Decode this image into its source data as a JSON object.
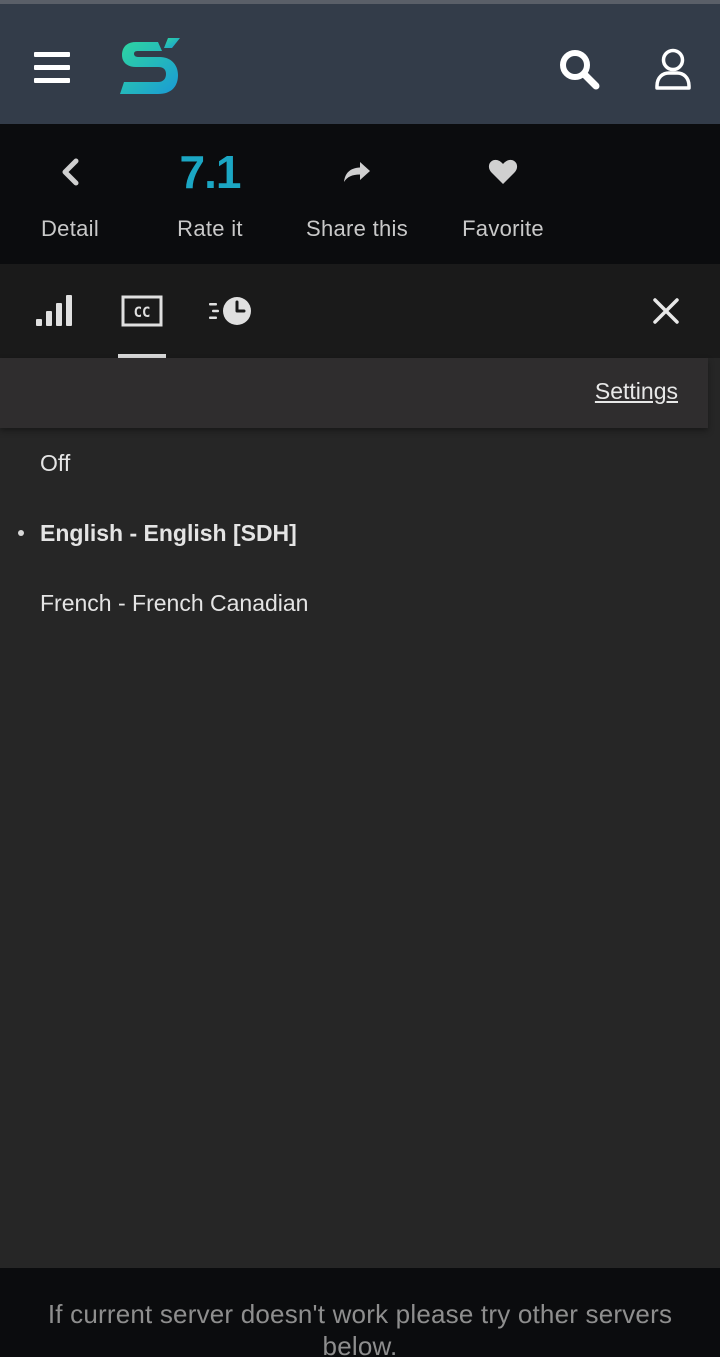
{
  "colors": {
    "header_bg": "#333c49",
    "action_bar_bg": "#0b0c0e",
    "panel_bg": "#262626",
    "rating_accent": "#1ba7c4",
    "logo_gradient_start": "#2ed6a0",
    "logo_gradient_end": "#1a9ad6"
  },
  "header": {
    "icons": {
      "menu": "hamburger-menu-icon",
      "logo": "site-logo",
      "search": "search-icon",
      "account": "user-icon"
    }
  },
  "actions": {
    "detail": {
      "label": "Detail",
      "icon": "chevron-left-icon"
    },
    "rate": {
      "value": "7.1",
      "label": "Rate it"
    },
    "share": {
      "label": "Share this",
      "icon": "share-icon"
    },
    "favorite": {
      "label": "Favorite",
      "icon": "heart-icon"
    }
  },
  "panel": {
    "tabs": [
      {
        "id": "quality",
        "icon": "signal-bars-icon",
        "active": false
      },
      {
        "id": "subtitles",
        "icon": "cc-icon",
        "text": "CC",
        "active": true
      },
      {
        "id": "speed",
        "icon": "speed-clock-icon",
        "active": false
      }
    ],
    "close_icon": "close-icon",
    "settings_label": "Settings",
    "subtitles": [
      {
        "label": "Off",
        "selected": false
      },
      {
        "label": "English - English [SDH]",
        "selected": true
      },
      {
        "label": "French - French Canadian",
        "selected": false
      }
    ]
  },
  "footer": {
    "notice": "If current server doesn't work please try other servers below."
  }
}
